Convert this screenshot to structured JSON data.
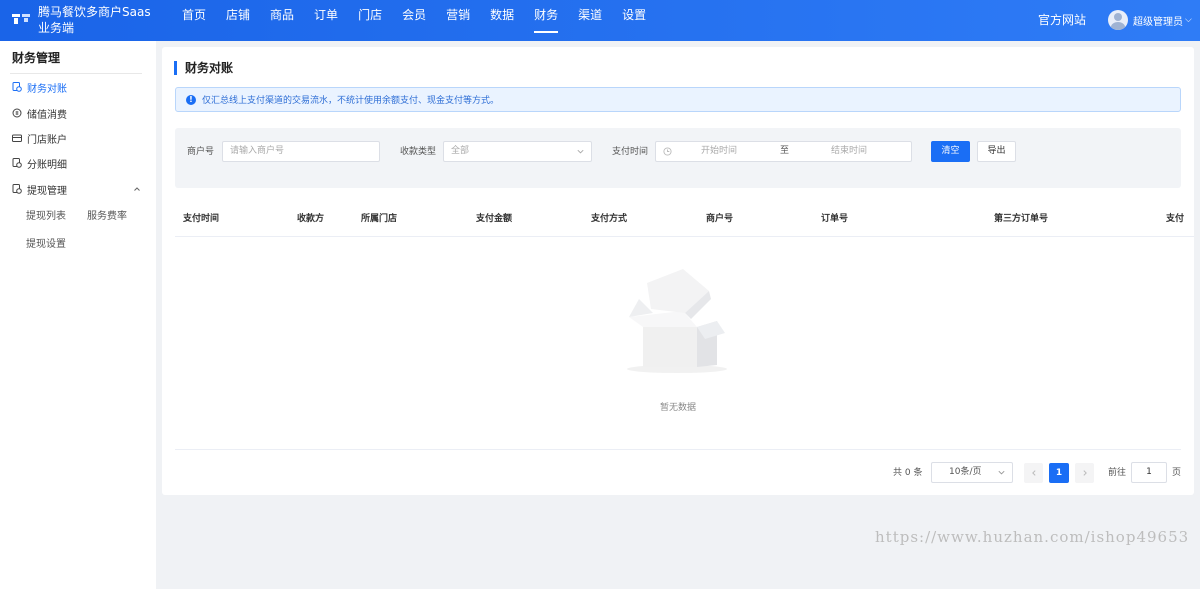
{
  "brand": {
    "name": "腾马餐饮多商户Saas业务端"
  },
  "nav": {
    "items": [
      {
        "label": "首页"
      },
      {
        "label": "店铺"
      },
      {
        "label": "商品"
      },
      {
        "label": "订单"
      },
      {
        "label": "门店"
      },
      {
        "label": "会员"
      },
      {
        "label": "营销"
      },
      {
        "label": "数据"
      },
      {
        "label": "财务",
        "active": true
      },
      {
        "label": "渠道"
      },
      {
        "label": "设置"
      }
    ],
    "official_site": "官方网站",
    "user_name": "超级管理员",
    "user_chevron": "⌵"
  },
  "sidebar": {
    "title": "财务管理",
    "items": [
      {
        "label": "财务对账",
        "icon": "reconcile-icon",
        "active": true
      },
      {
        "label": "储值消费",
        "icon": "coin-icon"
      },
      {
        "label": "门店账户",
        "icon": "card-icon"
      },
      {
        "label": "分账明细",
        "icon": "split-icon"
      },
      {
        "label": "提现管理",
        "icon": "withdraw-icon",
        "expanded": true
      }
    ],
    "sub_items": [
      {
        "label": "提现列表"
      },
      {
        "label": "服务费率"
      },
      {
        "label": "提现设置"
      }
    ]
  },
  "main": {
    "title": "财务对账",
    "notice": "仅汇总线上支付渠道的交易流水，不统计使用余额支付、现金支付等方式。",
    "filter": {
      "merchant_label": "商户号",
      "merchant_placeholder": "请输入商户号",
      "type_label": "收款类型",
      "type_value": "全部",
      "time_label": "支付时间",
      "start_placeholder": "开始时间",
      "range_sep": "至",
      "end_placeholder": "结束时间",
      "clear_button": "清空",
      "export_button": "导出"
    },
    "table": {
      "columns": [
        "支付时间",
        "收款方",
        "所属门店",
        "支付金额",
        "支付方式",
        "商户号",
        "订单号",
        "第三方订单号",
        "支付"
      ],
      "rows": [],
      "empty_text": "暂无数据"
    },
    "pagination": {
      "total": "共 0 条",
      "page_size": "10条/页",
      "current_page": "1",
      "goto_label": "前往",
      "goto_value": "1",
      "page_unit": "页"
    }
  },
  "watermark": "https://www.huzhan.com/ishop49653",
  "colors": {
    "primary": "#1a6ef5",
    "header": "#2f7cf6",
    "background": "#f0f2f5"
  }
}
